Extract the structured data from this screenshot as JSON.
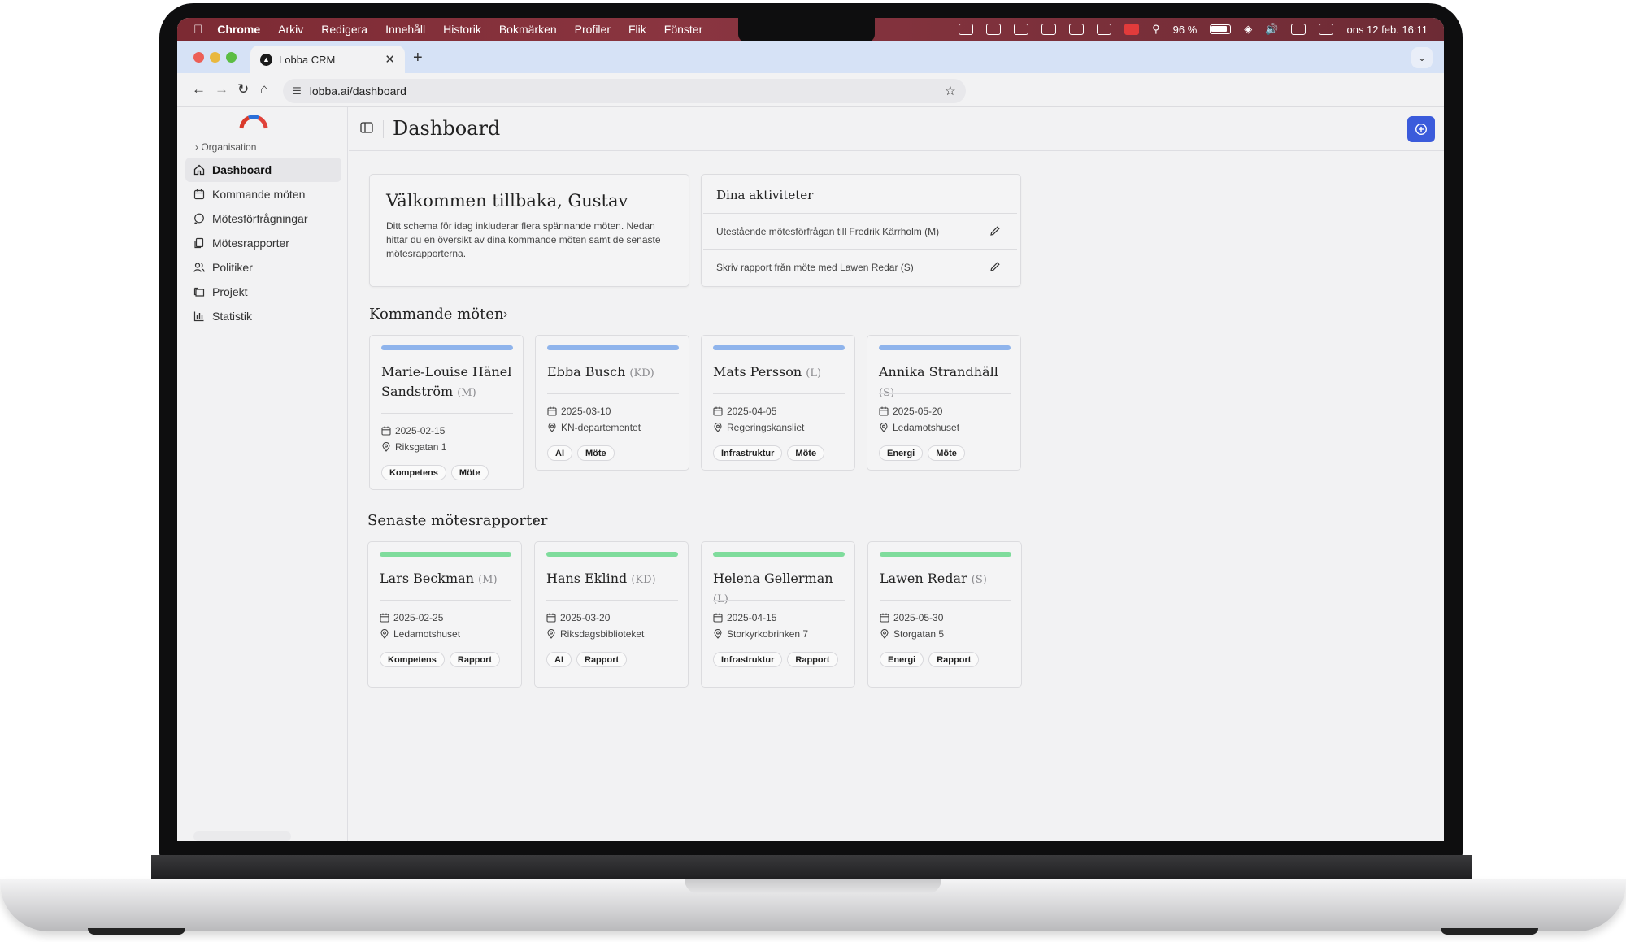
{
  "menubar": {
    "items": [
      "Chrome",
      "Arkiv",
      "Redigera",
      "Innehåll",
      "Historik",
      "Bokmärken",
      "Profiler",
      "Flik",
      "Fönster"
    ],
    "battery": "96 %",
    "datetime": "ons 12 feb. 16:11"
  },
  "browser": {
    "tab_title": "Lobba CRM",
    "url": "lobba.ai/dashboard"
  },
  "sidebar": {
    "org_label": "Organisation",
    "items": [
      {
        "label": "Dashboard",
        "icon": "home-icon"
      },
      {
        "label": "Kommande möten",
        "icon": "calendar-icon"
      },
      {
        "label": "Mötesförfrågningar",
        "icon": "message-icon"
      },
      {
        "label": "Mötesrapporter",
        "icon": "document-icon"
      },
      {
        "label": "Politiker",
        "icon": "users-icon"
      },
      {
        "label": "Projekt",
        "icon": "folder-icon"
      },
      {
        "label": "Statistik",
        "icon": "chart-icon"
      }
    ]
  },
  "header": {
    "title": "Dashboard"
  },
  "welcome": {
    "title": "Välkommen tillbaka, Gustav",
    "text": "Ditt schema för idag inkluderar flera spännande möten. Nedan hittar du en översikt av dina kommande möten samt de senaste mötesrapporterna."
  },
  "activities": {
    "title": "Dina aktiviteter",
    "items": [
      "Utestående mötesförfrågan till Fredrik Kärrholm (M)",
      "Skriv rapport från möte med Lawen Redar (S)"
    ]
  },
  "upcoming": {
    "title": "Kommande möten",
    "accent": "#8fb4ec",
    "cards": [
      {
        "name": "Marie-Louise Hänel Sandström",
        "party": "(M)",
        "date": "2025-02-15",
        "place": "Riksgatan 1",
        "tags": [
          "Kompetens",
          "Möte"
        ]
      },
      {
        "name": "Ebba Busch",
        "party": "(KD)",
        "date": "2025-03-10",
        "place": "KN-departementet",
        "tags": [
          "AI",
          "Möte"
        ]
      },
      {
        "name": "Mats Persson",
        "party": "(L)",
        "date": "2025-04-05",
        "place": "Regeringskansliet",
        "tags": [
          "Infrastruktur",
          "Möte"
        ]
      },
      {
        "name": "Annika Strandhäll",
        "party": "(S)",
        "date": "2025-05-20",
        "place": "Ledamotshuset",
        "tags": [
          "Energi",
          "Möte"
        ]
      }
    ]
  },
  "reports": {
    "title": "Senaste mötesrapporter",
    "accent": "#7fdc9c",
    "cards": [
      {
        "name": "Lars Beckman",
        "party": "(M)",
        "date": "2025-02-25",
        "place": "Ledamotshuset",
        "tags": [
          "Kompetens",
          "Rapport"
        ]
      },
      {
        "name": "Hans Eklind",
        "party": "(KD)",
        "date": "2025-03-20",
        "place": "Riksdagsbiblioteket",
        "tags": [
          "AI",
          "Rapport"
        ]
      },
      {
        "name": "Helena Gellerman",
        "party": "(L)",
        "date": "2025-04-15",
        "place": "Storkyrkobrinken 7",
        "tags": [
          "Infrastruktur",
          "Rapport"
        ]
      },
      {
        "name": "Lawen Redar",
        "party": "(S)",
        "date": "2025-05-30",
        "place": "Storgatan 5",
        "tags": [
          "Energi",
          "Rapport"
        ]
      }
    ]
  },
  "colors": {
    "primary_button": "#3b5bdb",
    "menubar": "#7c2a33",
    "tabstrip": "#d6e2f6"
  }
}
